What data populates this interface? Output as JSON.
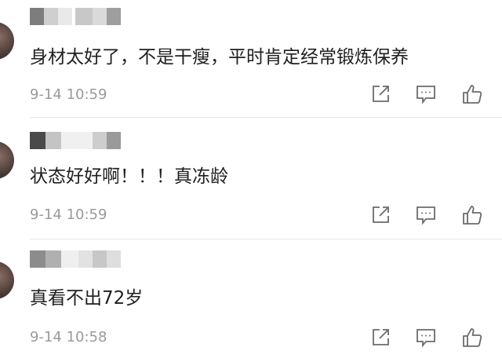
{
  "comments": [
    {
      "text": "身材太好了，不是干瘦，平时肯定经常锻炼保养",
      "time": "9-14 10:59"
    },
    {
      "text": "状态好好啊！！！真冻龄",
      "time": "9-14 10:59"
    },
    {
      "text": "真看不出72岁",
      "time": "9-14 10:58"
    }
  ],
  "icons": [
    "share-icon",
    "comment-icon",
    "like-icon"
  ],
  "colors": {
    "text": "#1f1f1f",
    "meta": "#9a9a9a",
    "icon": "#6b6b6b",
    "divider": "#e6e6e6"
  }
}
